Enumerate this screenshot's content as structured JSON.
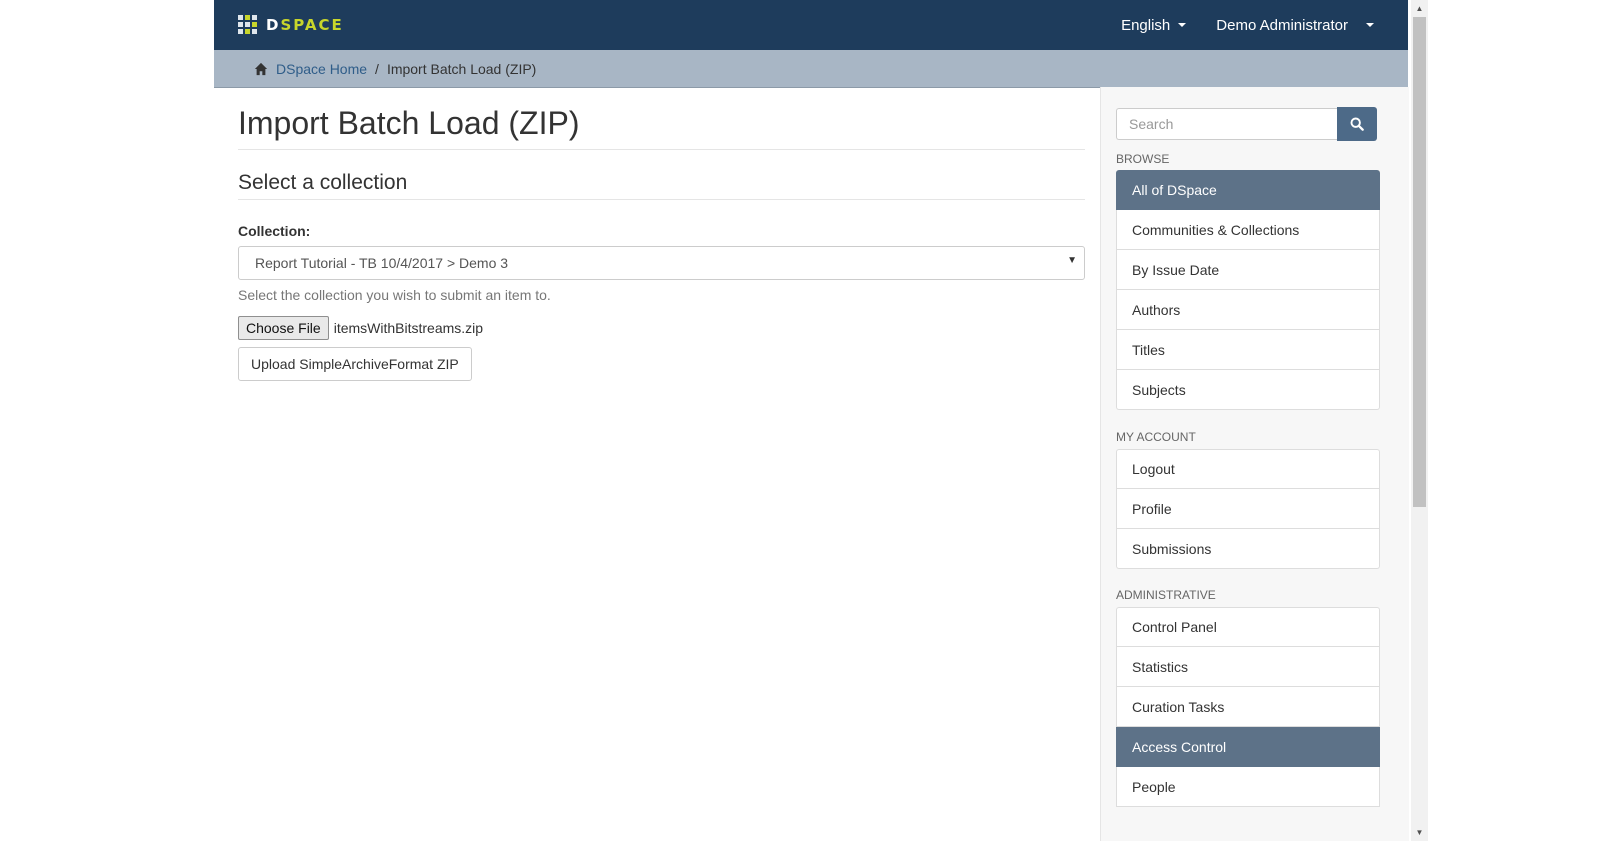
{
  "header": {
    "logo_text": "DSPACE",
    "language": "English",
    "user": "Demo Administrator"
  },
  "breadcrumb": {
    "home": "DSpace Home",
    "separator": "/",
    "current": "Import Batch Load (ZIP)"
  },
  "main": {
    "title": "Import Batch Load (ZIP)",
    "subtitle": "Select a collection",
    "collection_label": "Collection:",
    "collection_value": "Report Tutorial - TB 10/4/2017 > Demo 3",
    "help_text": "Select the collection you wish to submit an item to.",
    "choose_file_label": "Choose File",
    "file_name": "itemsWithBitstreams.zip",
    "upload_label": "Upload SimpleArchiveFormat ZIP"
  },
  "sidebar": {
    "search_placeholder": "Search",
    "browse_title": "BROWSE",
    "browse_items": [
      {
        "label": "All of DSpace",
        "active": true
      },
      {
        "label": "Communities & Collections",
        "active": false
      },
      {
        "label": "By Issue Date",
        "active": false
      },
      {
        "label": "Authors",
        "active": false
      },
      {
        "label": "Titles",
        "active": false
      },
      {
        "label": "Subjects",
        "active": false
      }
    ],
    "account_title": "MY ACCOUNT",
    "account_items": [
      {
        "label": "Logout"
      },
      {
        "label": "Profile"
      },
      {
        "label": "Submissions"
      }
    ],
    "admin_title": "ADMINISTRATIVE",
    "admin_items": [
      {
        "label": "Control Panel",
        "active": false
      },
      {
        "label": "Statistics",
        "active": false
      },
      {
        "label": "Curation Tasks",
        "active": false
      },
      {
        "label": "Access Control",
        "active": true
      },
      {
        "label": "People",
        "active": false
      }
    ]
  },
  "colors": {
    "topbar": "#1e3c5c",
    "breadcrumb_bar": "#a8b6c5",
    "active_item": "#5d7288",
    "search_button": "#4d6a88",
    "logo_accent": "#c8d62b"
  }
}
